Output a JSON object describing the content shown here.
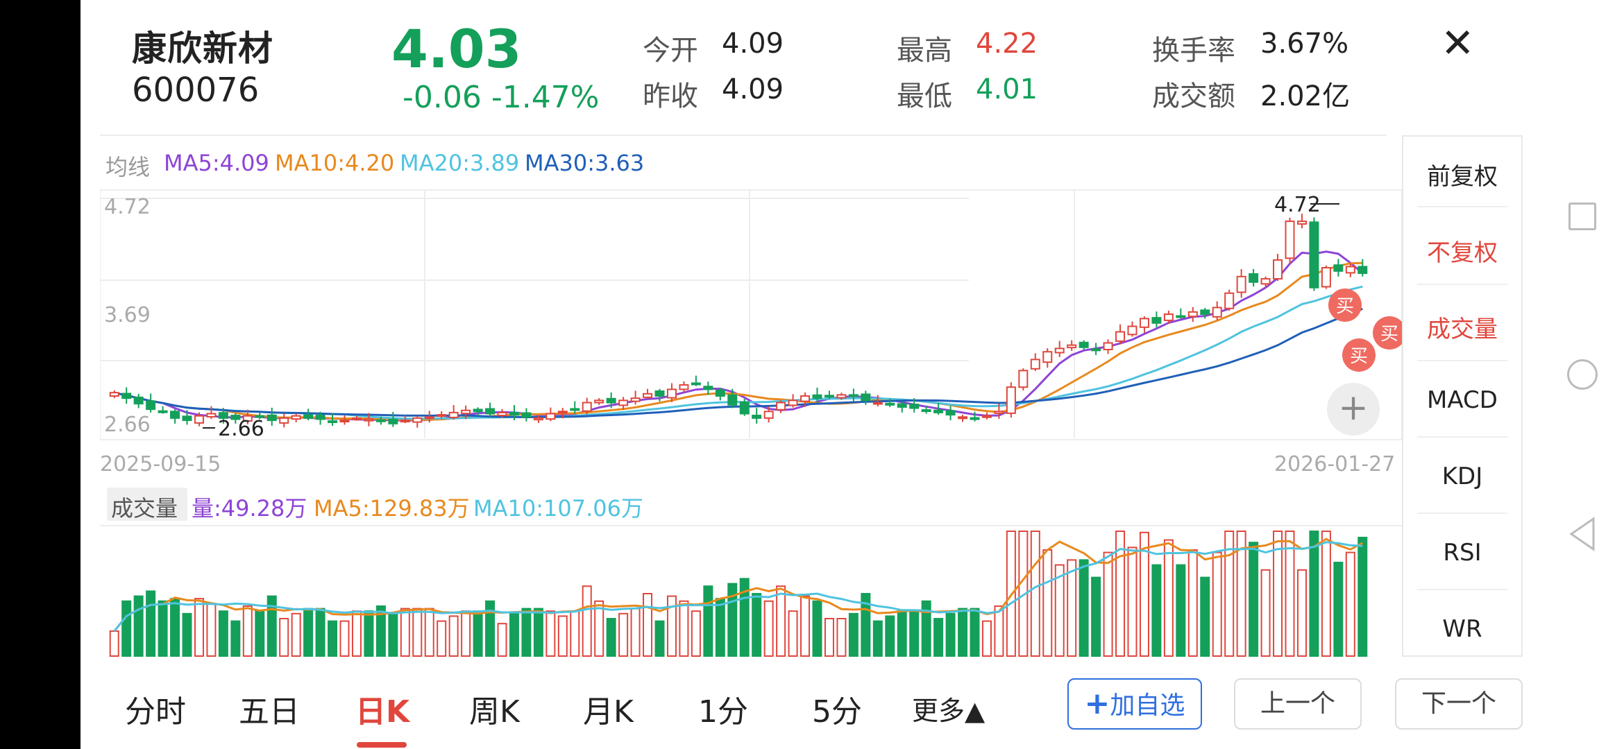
{
  "stock": {
    "name": "康欣新材",
    "code": "600076",
    "price": "4.03",
    "change": "-0.06 -1.47%",
    "close_icon": "close-icon"
  },
  "quote": {
    "open_label": "今开",
    "open_value": "4.09",
    "prev_close_label": "昨收",
    "prev_close_value": "4.09",
    "high_label": "最高",
    "high_value": "4.22",
    "low_label": "最低",
    "low_value": "4.01",
    "turnover_rate_label": "换手率",
    "turnover_rate_value": "3.67%",
    "amount_label": "成交额",
    "amount_value": "2.02亿"
  },
  "colors": {
    "up": "#e0463c",
    "down": "#14a05a",
    "ma5": "#8e44d6",
    "ma10": "#e8891e",
    "ma20": "#4fc3e0",
    "ma30": "#1f5fb8"
  },
  "ma_legend": {
    "label": "均线",
    "ma5": "MA5:4.09",
    "ma10": "MA10:4.20",
    "ma20": "MA20:3.89",
    "ma30": "MA30:3.63"
  },
  "chart_data": {
    "type": "candlestick",
    "y_ticks": [
      "4.72",
      "3.69",
      "2.66"
    ],
    "ylim": [
      2.6,
      4.72
    ],
    "start_date": "2025-09-15",
    "end_date": "2026-01-27",
    "high_annotation": "4.72",
    "low_annotation": "2.66",
    "closes": [
      2.95,
      2.9,
      2.85,
      2.8,
      2.78,
      2.72,
      2.7,
      2.74,
      2.76,
      2.72,
      2.71,
      2.74,
      2.73,
      2.7,
      2.72,
      2.74,
      2.72,
      2.71,
      2.69,
      2.7,
      2.72,
      2.71,
      2.7,
      2.67,
      2.7,
      2.72,
      2.73,
      2.75,
      2.77,
      2.79,
      2.78,
      2.76,
      2.77,
      2.75,
      2.73,
      2.72,
      2.76,
      2.78,
      2.8,
      2.86,
      2.88,
      2.86,
      2.88,
      2.9,
      2.94,
      2.92,
      2.98,
      3.02,
      3.03,
      2.98,
      2.92,
      2.84,
      2.76,
      2.72,
      2.78,
      2.86,
      2.88,
      2.92,
      2.9,
      2.92,
      2.93,
      2.92,
      2.88,
      2.86,
      2.84,
      2.82,
      2.81,
      2.79,
      2.77,
      2.75,
      2.73,
      2.72,
      2.74,
      2.78,
      3.0,
      3.15,
      3.25,
      3.32,
      3.35,
      3.38,
      3.36,
      3.34,
      3.4,
      3.5,
      3.55,
      3.62,
      3.58,
      3.66,
      3.64,
      3.68,
      3.66,
      3.72,
      3.85,
      4.0,
      3.95,
      3.98,
      4.15,
      4.5,
      4.5,
      3.9,
      4.08,
      4.05,
      4.09,
      4.03
    ],
    "volume": {
      "label": "成交量",
      "current": "量:49.28万",
      "ma5": "MA5:129.83万",
      "ma10": "MA10:107.06万"
    },
    "signals": [
      "买",
      "买",
      "买"
    ]
  },
  "side_menu": {
    "items": [
      "前复权",
      "不复权",
      "成交量",
      "MACD",
      "KDJ",
      "RSI",
      "WR"
    ]
  },
  "tabs": [
    "分时",
    "五日",
    "日K",
    "周K",
    "月K",
    "1分",
    "5分",
    "更多▲"
  ],
  "active_tab": "日K",
  "buttons": {
    "add_favorite": "加自选",
    "prev": "上一个",
    "next": "下一个"
  }
}
